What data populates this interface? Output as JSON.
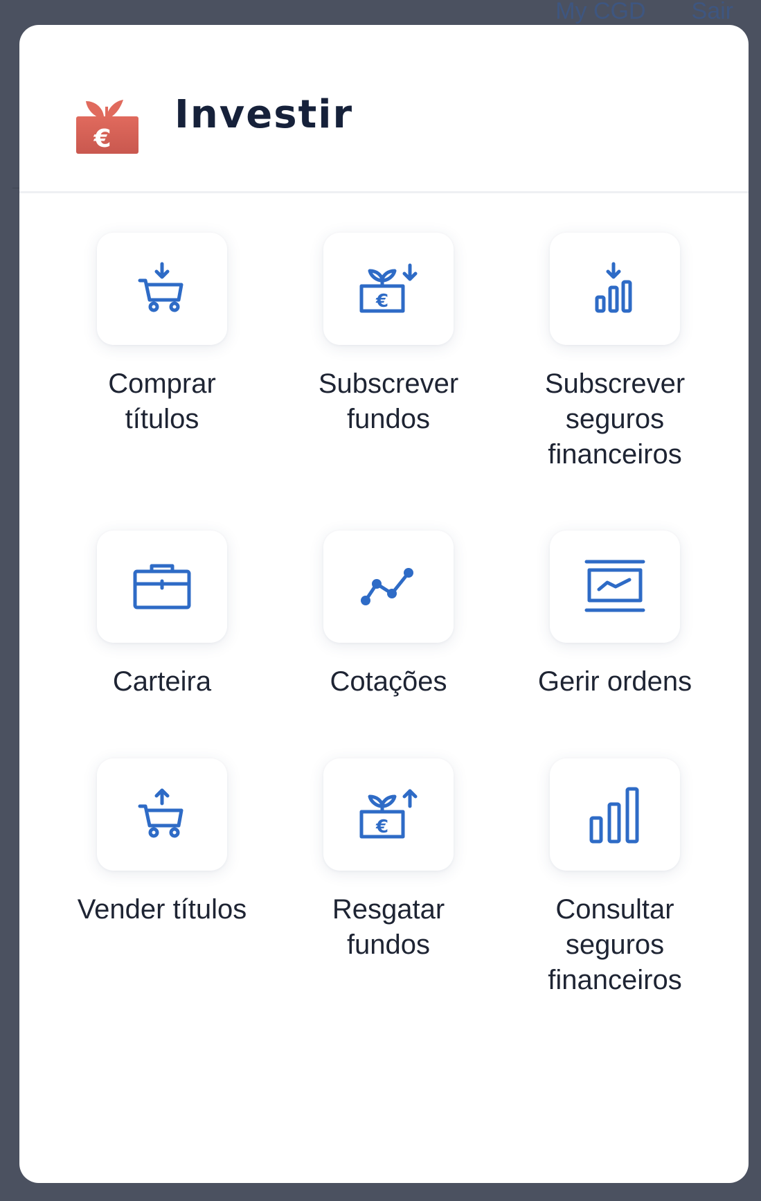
{
  "topnav": {
    "my_cgd": "My CGD",
    "sair": "Sair"
  },
  "modal": {
    "title": "Investir",
    "header_icon": "investment-euro-plant-icon"
  },
  "colors": {
    "accent_blue": "#2e6bc6",
    "header_icon": "#d9645a",
    "backdrop": "#4b5160",
    "text": "#1e2433"
  },
  "tiles": [
    {
      "label": "Comprar\ntítulos",
      "icon": "cart-download-icon"
    },
    {
      "label": "Subscrever\nfundos",
      "icon": "fund-subscribe-icon"
    },
    {
      "label": "Subscrever\nseguros\nfinanceiros",
      "icon": "bars-download-icon"
    },
    {
      "label": "Carteira",
      "icon": "briefcase-icon"
    },
    {
      "label": "Cotações",
      "icon": "line-chart-icon"
    },
    {
      "label": "Gerir ordens",
      "icon": "screen-chart-icon"
    },
    {
      "label": "Vender títulos",
      "icon": "cart-upload-icon"
    },
    {
      "label": "Resgatar\nfundos",
      "icon": "fund-redeem-icon"
    },
    {
      "label": "Consultar\nseguros\nfinanceiros",
      "icon": "bar-chart-icon"
    }
  ]
}
